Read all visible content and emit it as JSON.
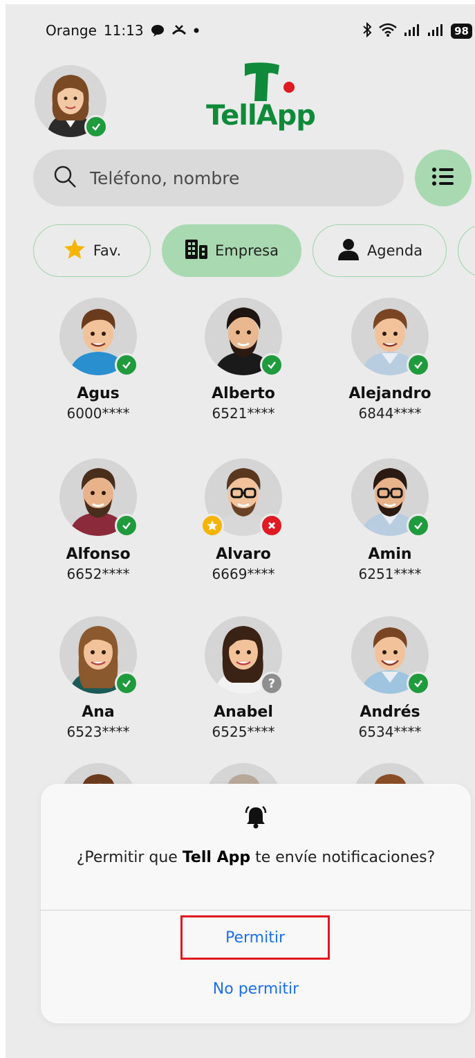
{
  "status_bar": {
    "carrier": "Orange",
    "time": "11:13",
    "battery": "98"
  },
  "app": {
    "logo_text": "TellApp"
  },
  "search": {
    "placeholder": "Teléfono, nombre"
  },
  "tabs": [
    {
      "label": "Fav.",
      "icon": "star-icon",
      "active": false
    },
    {
      "label": "Empresa",
      "icon": "building-icon",
      "active": true
    },
    {
      "label": "Agenda",
      "icon": "person-icon",
      "active": false
    }
  ],
  "contacts": [
    {
      "name": "Agus",
      "phone": "6000****",
      "status": "online"
    },
    {
      "name": "Alberto",
      "phone": "6521****",
      "status": "online"
    },
    {
      "name": "Alejandro",
      "phone": "6844****",
      "status": "online"
    },
    {
      "name": "Alfonso",
      "phone": "6652****",
      "status": "online"
    },
    {
      "name": "Alvaro",
      "phone": "6669****",
      "status": "unavailable",
      "favorite": true
    },
    {
      "name": "Amin",
      "phone": "6251****",
      "status": "online"
    },
    {
      "name": "Ana",
      "phone": "6523****",
      "status": "online"
    },
    {
      "name": "Anabel",
      "phone": "6525****",
      "status": "unknown"
    },
    {
      "name": "Andrés",
      "phone": "6534****",
      "status": "online"
    }
  ],
  "dialog": {
    "text_before": "¿Permitir que ",
    "app_name": "Tell App",
    "text_after": " te envíe notificaciones?",
    "allow_label": "Permitir",
    "deny_label": "No permitir"
  },
  "colors": {
    "brand_green": "#0e8a3a",
    "accent_green": "#a9d9b0",
    "status_green": "#1f9a3c",
    "status_red": "#e01a22",
    "link_blue": "#1a6ff0",
    "highlight_red": "#e0161e"
  }
}
